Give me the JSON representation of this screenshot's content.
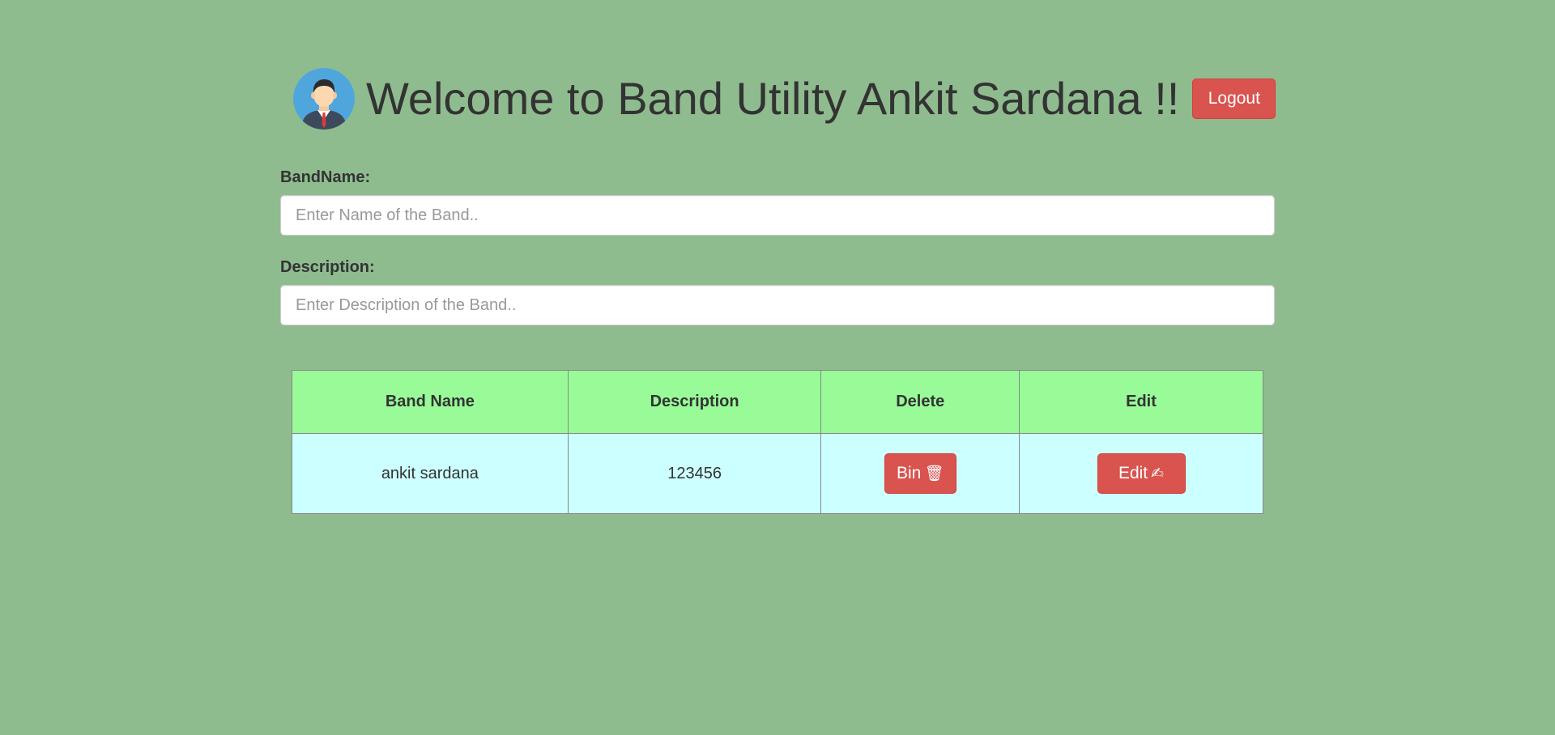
{
  "header": {
    "welcome_text": "Welcome to Band Utility Ankit Sardana !!",
    "logout_label": "Logout",
    "avatar_icon": "user-avatar-icon"
  },
  "form": {
    "band_name_label": "BandName:",
    "band_name_placeholder": "Enter Name of the Band..",
    "band_name_value": "",
    "description_label": "Description:",
    "description_placeholder": "Enter Description of the Band..",
    "description_value": ""
  },
  "table": {
    "headers": [
      "Band Name",
      "Description",
      "Delete",
      "Edit"
    ],
    "rows": [
      {
        "band_name": "ankit sardana",
        "description": "123456",
        "delete_label": "Bin",
        "delete_icon": "🗑",
        "edit_label": "Edit",
        "edit_icon": "✍"
      }
    ]
  },
  "colors": {
    "background": "#8fbc8f",
    "button_red": "#d9534f",
    "table_header": "#98fb98",
    "table_row": "#ccffff"
  }
}
